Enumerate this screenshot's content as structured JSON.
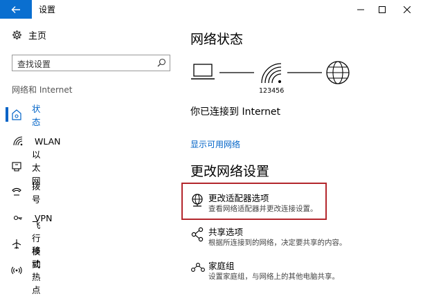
{
  "window": {
    "title": "设置"
  },
  "sidebar": {
    "home_label": "主页",
    "search_placeholder": "查找设置",
    "section_label": "网络和 Internet",
    "items": [
      {
        "label": "状态",
        "icon": "home-network-icon",
        "selected": true
      },
      {
        "label": "WLAN",
        "icon": "wifi-icon"
      },
      {
        "label": "以太网",
        "icon": "ethernet-icon"
      },
      {
        "label": "拨号",
        "icon": "dialup-icon"
      },
      {
        "label": "VPN",
        "icon": "vpn-icon"
      },
      {
        "label": "飞行模式",
        "icon": "airplane-icon"
      },
      {
        "label": "移动热点",
        "icon": "hotspot-icon"
      }
    ]
  },
  "main": {
    "heading": "网络状态",
    "ssid": "123456",
    "connection_status": "你已连接到 Internet",
    "show_networks_link": "显示可用网络",
    "change_heading": "更改网络设置",
    "options": [
      {
        "title": "更改适配器选项",
        "desc": "查看网络适配器并更改连接设置。",
        "icon": "adapter-globe-icon"
      },
      {
        "title": "共享选项",
        "desc": "根据所连接到的网络，决定要共享的内容。",
        "icon": "share-icon"
      },
      {
        "title": "家庭组",
        "desc": "设置家庭组，与网络上的其他电脑共享。",
        "icon": "homegroup-icon"
      }
    ]
  },
  "colors": {
    "accent": "#0063c7",
    "titlebar_back": "#0a6fd0",
    "highlight": "#b3262c"
  }
}
